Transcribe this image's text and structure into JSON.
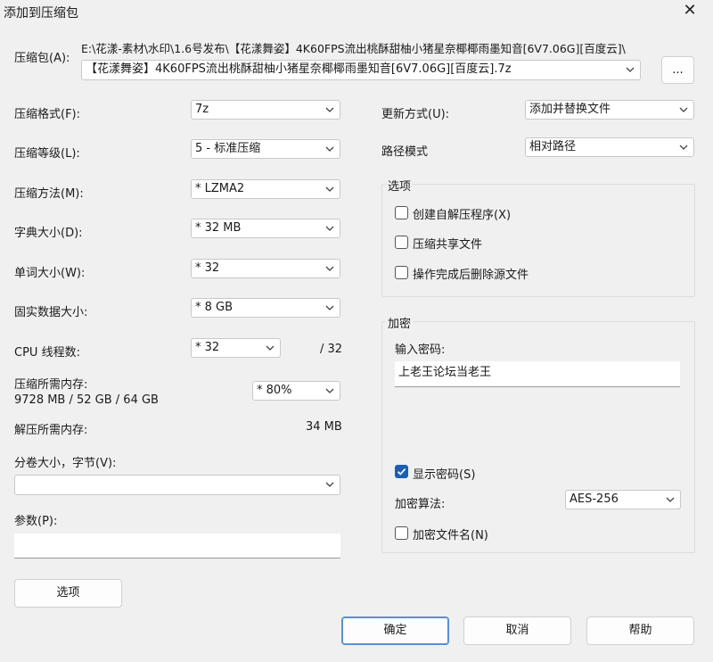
{
  "window": {
    "title": "添加到压缩包",
    "close_glyph": "✕"
  },
  "archive": {
    "label": "压缩包(A):",
    "path": "E:\\花漾-素材\\水印\\1.6号发布\\【花漾舞姿】4K60FPS流出桃酥甜柚小猪星奈椰椰雨墨知音[6V7.06G][百度云]\\",
    "filename": "【花漾舞姿】4K60FPS流出桃酥甜柚小猪星奈椰椰雨墨知音[6V7.06G][百度云].7z",
    "browse_label": "..."
  },
  "left": {
    "format": {
      "label": "压缩格式(F):",
      "value": "7z"
    },
    "level": {
      "label": "压缩等级(L):",
      "value": "5 - 标准压缩"
    },
    "method": {
      "label": "压缩方法(M):",
      "value": "*  LZMA2"
    },
    "dict": {
      "label": "字典大小(D):",
      "value": "*  32 MB"
    },
    "word": {
      "label": "单词大小(W):",
      "value": "*  32"
    },
    "solid": {
      "label": "固实数据大小:",
      "value": "*  8 GB"
    },
    "threads": {
      "label": "CPU 线程数:",
      "value": "*  32",
      "max": "/ 32"
    },
    "mem_compress": {
      "label": "压缩所需内存:",
      "detail": "9728 MB / 52 GB / 64 GB",
      "value": "*  80%"
    },
    "mem_decompress": {
      "label": "解压所需内存:",
      "value": "34 MB"
    },
    "volume": {
      "label": "分卷大小，字节(V):",
      "value": ""
    },
    "params": {
      "label": "参数(P):",
      "value": ""
    },
    "options_button": "选项"
  },
  "right": {
    "update": {
      "label": "更新方式(U):",
      "value": "添加并替换文件"
    },
    "path_mode": {
      "label": "路径模式",
      "value": "相对路径"
    },
    "options_group": {
      "title": "选项",
      "items": [
        {
          "label": "创建自解压程序(X)",
          "checked": false
        },
        {
          "label": "压缩共享文件",
          "checked": false
        },
        {
          "label": "操作完成后删除源文件",
          "checked": false
        }
      ]
    },
    "encryption": {
      "title": "加密",
      "password_label": "输入密码:",
      "password": "上老王论坛当老王",
      "show_password": {
        "label": "显示密码(S)",
        "checked": true
      },
      "algo_label": "加密算法:",
      "algo_value": "AES-256",
      "encrypt_names": {
        "label": "加密文件名(N)",
        "checked": false
      }
    }
  },
  "buttons": {
    "ok": "确定",
    "cancel": "取消",
    "help": "帮助"
  },
  "colors": {
    "accent": "#1a5fb4",
    "primary_border": "#5b8fd6"
  }
}
